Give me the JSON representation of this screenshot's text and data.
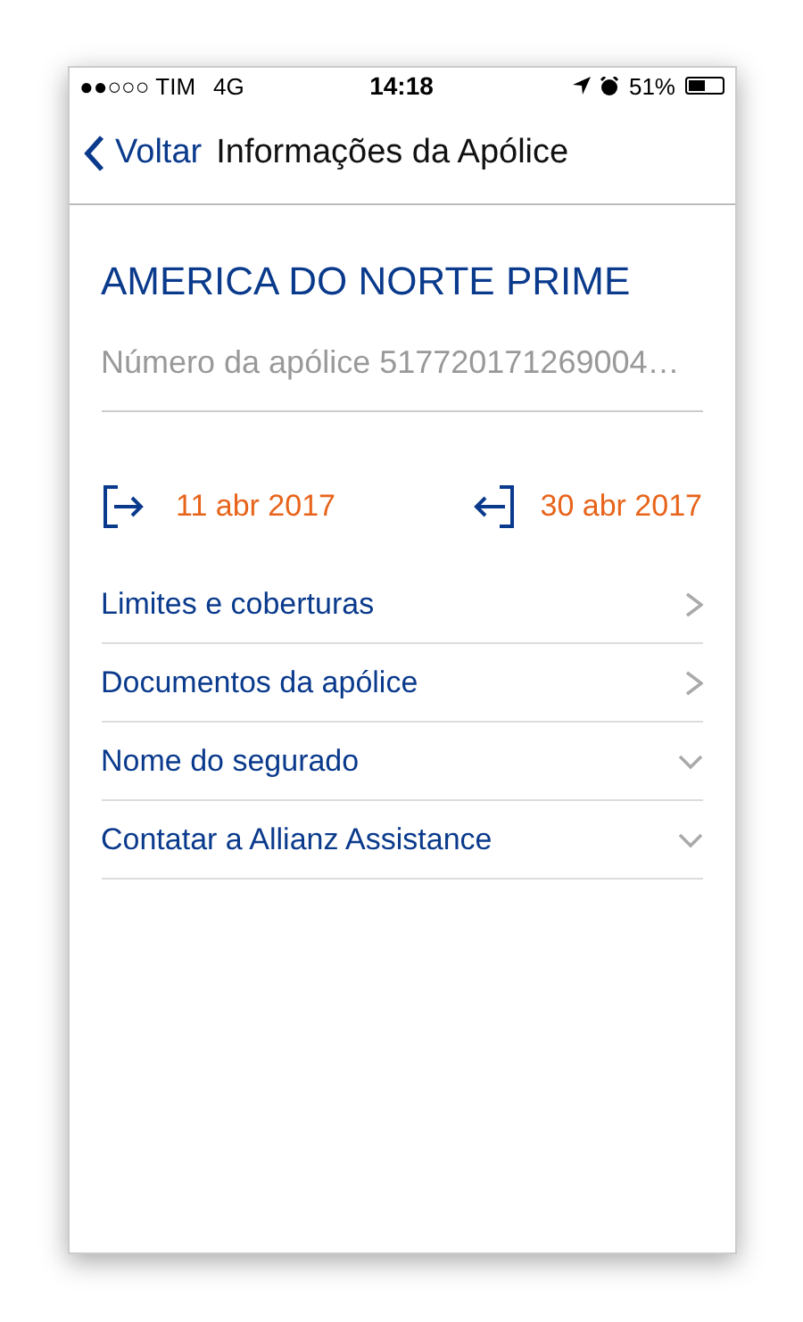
{
  "status_bar": {
    "carrier": "●●○○○ TIM",
    "network": "4G",
    "time": "14:18",
    "battery": "51%"
  },
  "nav": {
    "back": "Voltar",
    "title": "Informações da Apólice"
  },
  "policy": {
    "name": "AMERICA DO NORTE PRIME",
    "number": "Número da apólice 517720171269004…",
    "start_date": "11 abr 2017",
    "end_date": "30 abr 2017"
  },
  "items": [
    {
      "label": "Limites e coberturas",
      "kind": "link"
    },
    {
      "label": "Documentos da apólice",
      "kind": "link"
    },
    {
      "label": "Nome do segurado",
      "kind": "expand"
    },
    {
      "label": "Contatar a Allianz Assistance",
      "kind": "expand"
    }
  ]
}
